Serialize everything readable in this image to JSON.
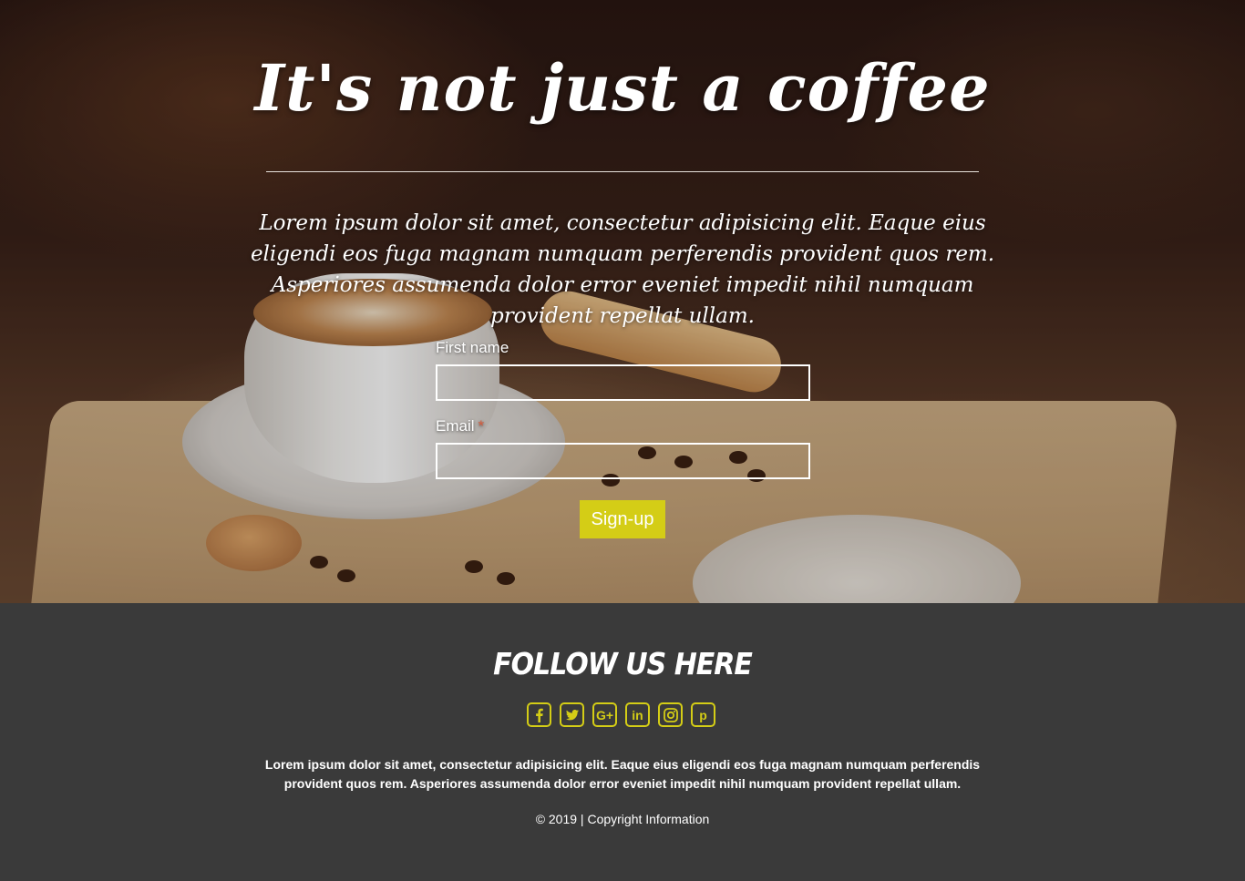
{
  "hero": {
    "title": "It's not just a coffee",
    "intro": "Lorem ipsum dolor sit amet, consectetur adipisicing elit. Eaque eius eligendi eos fuga magnam numquam perferendis provident quos rem. Asperiores assumenda dolor error eveniet impedit nihil numquam provident repellat ullam."
  },
  "form": {
    "first_name_label": "First name",
    "first_name_value": "",
    "email_label": "Email",
    "email_required_mark": "*",
    "email_value": "",
    "submit_label": "Sign-up",
    "submit_color": "#d4cd16"
  },
  "footer": {
    "heading": "FOLLOW US HERE",
    "social": [
      {
        "icon": "facebook-icon"
      },
      {
        "icon": "twitter-icon"
      },
      {
        "icon": "google-plus-icon",
        "glyph": "G+"
      },
      {
        "icon": "linkedin-icon",
        "glyph": "in"
      },
      {
        "icon": "instagram-icon"
      },
      {
        "icon": "pinterest-icon",
        "glyph": "p"
      }
    ],
    "text": "Lorem ipsum dolor sit amet, consectetur adipisicing elit. Eaque eius eligendi eos fuga magnam numquam perferendis provident quos rem. Asperiores assumenda dolor error eveniet impedit nihil numquam provident repellat ullam.",
    "copyright": "© 2019 | Copyright Information",
    "accent_color": "#d4cd16",
    "background_color": "#3a3a3a"
  }
}
